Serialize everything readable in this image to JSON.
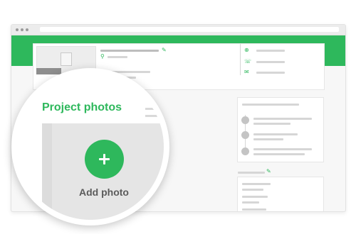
{
  "colors": {
    "accent": "#2eb85c",
    "frame": "#f7f7f7",
    "placeholder_bar": "#d6d6d6",
    "label": "#5b5b5b"
  },
  "magnifier": {
    "title": "Project photos",
    "add_button_label": "Add photo",
    "add_button_icon": "plus-icon"
  },
  "profile": {
    "edit_icon": "pencil-icon",
    "location_icon": "map-pin-icon"
  },
  "contact": {
    "icons": [
      "globe-icon",
      "phone-icon",
      "mail-icon"
    ]
  },
  "activity": {
    "icons": [
      "clock-icon",
      "briefcase-icon",
      "user-icon"
    ]
  },
  "reviews": {
    "edit_icon": "pencil-icon"
  }
}
